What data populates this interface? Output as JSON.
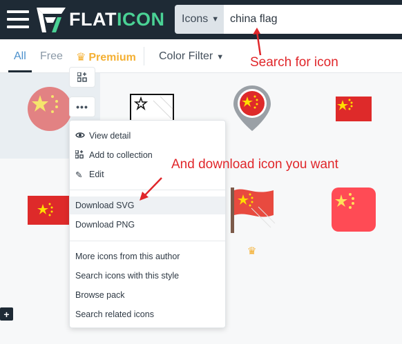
{
  "header": {
    "logo_text_1": "FLAT",
    "logo_text_2": "ICON",
    "search_type_label": "Icons",
    "search_value": "china flag"
  },
  "filters": {
    "all": "All",
    "free": "Free",
    "premium": "Premium",
    "color_filter": "Color Filter"
  },
  "menu": {
    "view_detail": "View detail",
    "add_to_collection": "Add to collection",
    "edit": "Edit",
    "download_svg": "Download SVG",
    "download_png": "Download PNG",
    "more_icons": "More icons from this author",
    "search_style": "Search icons with this style",
    "browse_pack": "Browse pack",
    "search_related": "Search related icons"
  },
  "annotations": {
    "search": "Search for icon",
    "download": "And download icon you want"
  },
  "colors": {
    "header_bg": "#1e2a35",
    "brand_green": "#4ad295",
    "flag_red": "#de2a2a",
    "flag_yellow": "#ffde00",
    "premium": "#f4b033",
    "annotation_red": "#e0262a"
  },
  "icons": {
    "menu": "hamburger-icon",
    "view": "eye-icon",
    "collection": "add-collection-icon",
    "edit": "pencil-icon",
    "premium": "crown-icon"
  }
}
